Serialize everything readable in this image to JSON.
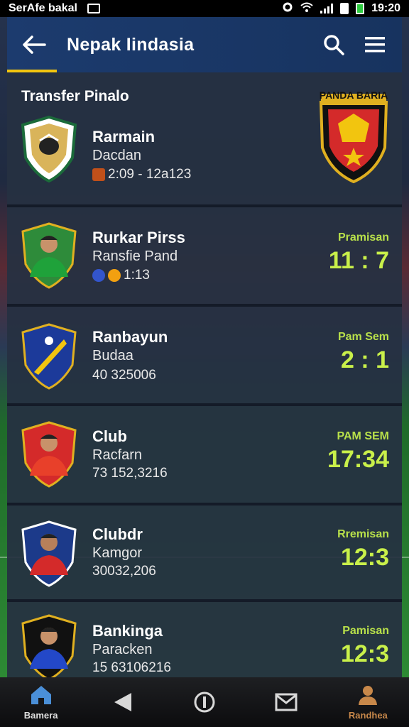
{
  "status_bar": {
    "carrier": "SerAfe bakal",
    "time": "19:20"
  },
  "app_bar": {
    "title": "Nepak Iindasia"
  },
  "section_title": "Transfer Pinalo",
  "featured_crest_text": "PANDA BARIA",
  "cards": [
    {
      "name": "Rarmain",
      "subtitle": "Dacdan",
      "meta": "2:09 - 12a123",
      "score_label": "",
      "score": ""
    },
    {
      "name": "Rurkar Pirss",
      "subtitle": "Ransfie Pand",
      "meta": "1:13",
      "score_label": "Pramisan",
      "score": "11 : 7"
    },
    {
      "name": "Ranbayun",
      "subtitle": "Budaa",
      "meta": "40 325006",
      "score_label": "Pam Sem",
      "score": "2 : 1"
    },
    {
      "name": "Club",
      "subtitle": "Racfarn",
      "meta": "73 152,3216",
      "score_label": "PAM SEM",
      "score": "17:34"
    },
    {
      "name": "Clubdr",
      "subtitle": "Kamgor",
      "meta": "30032,206",
      "score_label": "Rremisan",
      "score": "12:3"
    },
    {
      "name": "Bankinga",
      "subtitle": "Paracken",
      "meta": "15 63106216",
      "score_label": "Pamisan",
      "score": "12:3"
    }
  ],
  "bottom_nav": [
    {
      "label": "Bamera",
      "icon": "home-icon"
    },
    {
      "label": "",
      "icon": "back-triangle-icon"
    },
    {
      "label": "",
      "icon": "info-circle-icon"
    },
    {
      "label": "",
      "icon": "mail-icon"
    },
    {
      "label": "Randhea",
      "icon": "profile-icon"
    }
  ],
  "colors": {
    "accent": "#f2c50f",
    "score": "#c9f04a",
    "appbar": "#1c3b6e",
    "card": "#263042"
  }
}
